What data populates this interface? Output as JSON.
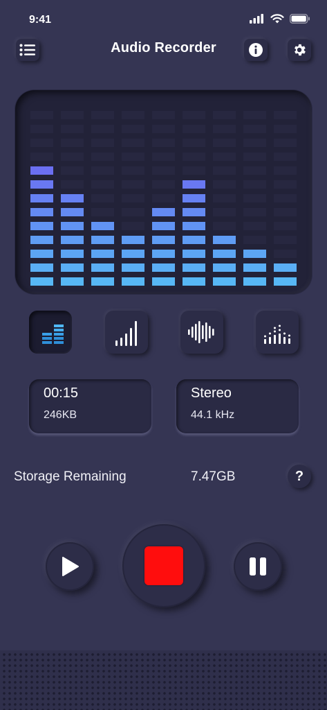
{
  "status": {
    "time": "9:41"
  },
  "header": {
    "title": "Audio Recorder"
  },
  "visualizer": {
    "levels": [
      9,
      7,
      5,
      4,
      6,
      8,
      4,
      3,
      2
    ],
    "max_level": 13,
    "colors": {
      "low": "#57b7f5",
      "high": "#6b6ff2"
    }
  },
  "modes": [
    {
      "name": "equalizer-bars",
      "active": true
    },
    {
      "name": "signal-bars",
      "active": false
    },
    {
      "name": "waveform",
      "active": false
    },
    {
      "name": "dotted-spectrum",
      "active": false
    }
  ],
  "recording_info": {
    "duration": "00:15",
    "size": "246KB"
  },
  "format_info": {
    "channels": "Stereo",
    "sample_rate": "44.1 kHz"
  },
  "storage": {
    "label": "Storage Remaining",
    "value": "7.47GB",
    "help_label": "?"
  },
  "controls": {
    "play": "play-icon",
    "stop": "stop-icon",
    "pause": "pause-icon"
  },
  "colors": {
    "background": "#353553",
    "stop": "#ff0d0d"
  }
}
